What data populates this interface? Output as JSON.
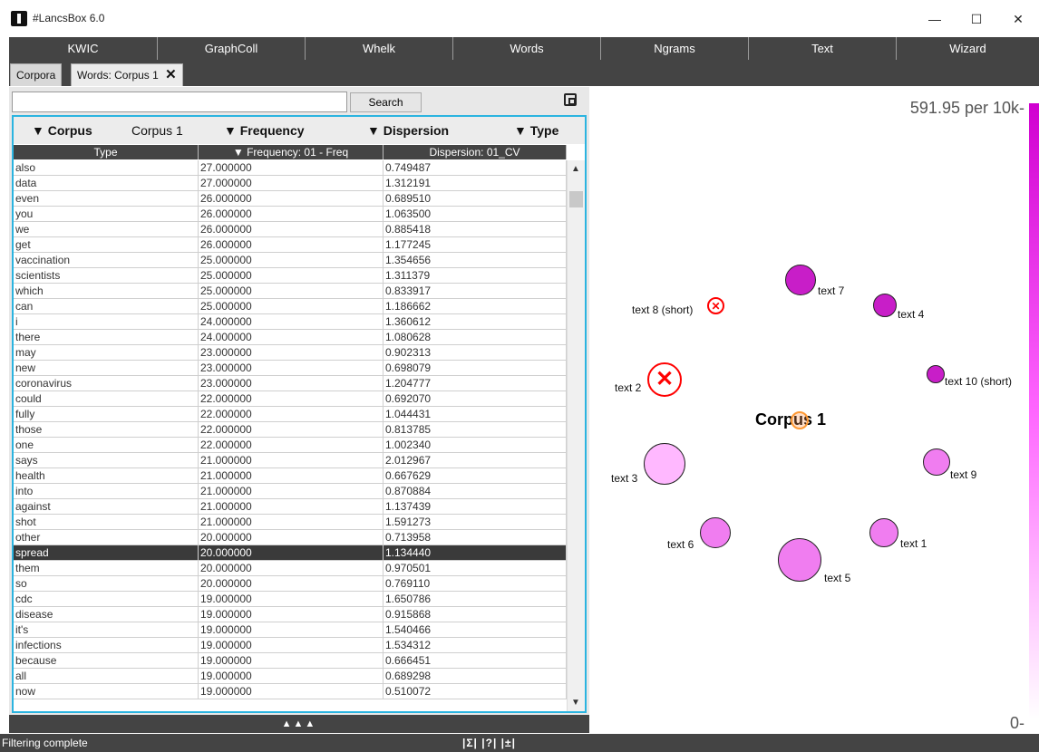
{
  "window": {
    "title": "#LancsBox 6.0",
    "minimize": "—",
    "maximize": "☐",
    "close": "✕"
  },
  "menu": [
    "KWIC",
    "GraphColl",
    "Whelk",
    "Words",
    "Ngrams",
    "Text",
    "Wizard"
  ],
  "tabs": {
    "corpora": "Corpora",
    "active": "Words: Corpus 1",
    "close_glyph": "✕"
  },
  "search": {
    "value": "",
    "button": "Search"
  },
  "filters": {
    "corpus_label": "▼ Corpus",
    "corpus_value": "Corpus 1",
    "frequency_label": "▼ Frequency",
    "dispersion_label": "▼ Dispersion",
    "type_label": "▼ Type"
  },
  "table": {
    "headers": [
      "Type",
      "▼ Frequency: 01 - Freq",
      "Dispersion: 01_CV"
    ],
    "rows": [
      [
        "also",
        "27.000000",
        "0.749487"
      ],
      [
        "data",
        "27.000000",
        "1.312191"
      ],
      [
        "even",
        "26.000000",
        "0.689510"
      ],
      [
        "you",
        "26.000000",
        "1.063500"
      ],
      [
        "we",
        "26.000000",
        "0.885418"
      ],
      [
        "get",
        "26.000000",
        "1.177245"
      ],
      [
        "vaccination",
        "25.000000",
        "1.354656"
      ],
      [
        "scientists",
        "25.000000",
        "1.311379"
      ],
      [
        "which",
        "25.000000",
        "0.833917"
      ],
      [
        "can",
        "25.000000",
        "1.186662"
      ],
      [
        "i",
        "24.000000",
        "1.360612"
      ],
      [
        "there",
        "24.000000",
        "1.080628"
      ],
      [
        "may",
        "23.000000",
        "0.902313"
      ],
      [
        "new",
        "23.000000",
        "0.698079"
      ],
      [
        "coronavirus",
        "23.000000",
        "1.204777"
      ],
      [
        "could",
        "22.000000",
        "0.692070"
      ],
      [
        "fully",
        "22.000000",
        "1.044431"
      ],
      [
        "those",
        "22.000000",
        "0.813785"
      ],
      [
        "one",
        "22.000000",
        "1.002340"
      ],
      [
        "says",
        "21.000000",
        "2.012967"
      ],
      [
        "health",
        "21.000000",
        "0.667629"
      ],
      [
        "into",
        "21.000000",
        "0.870884"
      ],
      [
        "against",
        "21.000000",
        "1.137439"
      ],
      [
        "shot",
        "21.000000",
        "1.591273"
      ],
      [
        "other",
        "20.000000",
        "0.713958"
      ],
      [
        "spread",
        "20.000000",
        "1.134440"
      ],
      [
        "them",
        "20.000000",
        "0.970501"
      ],
      [
        "so",
        "20.000000",
        "0.769110"
      ],
      [
        "cdc",
        "19.000000",
        "1.650786"
      ],
      [
        "disease",
        "19.000000",
        "0.915868"
      ],
      [
        "it's",
        "19.000000",
        "1.540466"
      ],
      [
        "infections",
        "19.000000",
        "1.534312"
      ],
      [
        "because",
        "19.000000",
        "0.666451"
      ],
      [
        "all",
        "19.000000",
        "0.689298"
      ],
      [
        "now",
        "19.000000",
        "0.510072"
      ]
    ],
    "selected_index": 25
  },
  "collapse_bar": "▲▲▲",
  "graph": {
    "scale_max": "591.95 per 10k-",
    "scale_min": "0-",
    "center_label": "Corpus 1",
    "nodes": [
      {
        "label": "text 7",
        "color": "#c81ec8"
      },
      {
        "label": "text 4",
        "color": "#c81ec8"
      },
      {
        "label": "text 10 (short)",
        "color": "#c81ec8"
      },
      {
        "label": "text 9",
        "color": "#f07df0"
      },
      {
        "label": "text 1",
        "color": "#f07df0"
      },
      {
        "label": "text 5",
        "color": "#f07df0"
      },
      {
        "label": "text 6",
        "color": "#f07df0"
      },
      {
        "label": "text 3",
        "color": "#ffb8ff"
      }
    ],
    "excluded": [
      {
        "label": "text 8 (short)"
      },
      {
        "label": "text 2"
      }
    ]
  },
  "status": {
    "text": "Filtering complete",
    "icons": "|Σ| |?| |±|"
  }
}
